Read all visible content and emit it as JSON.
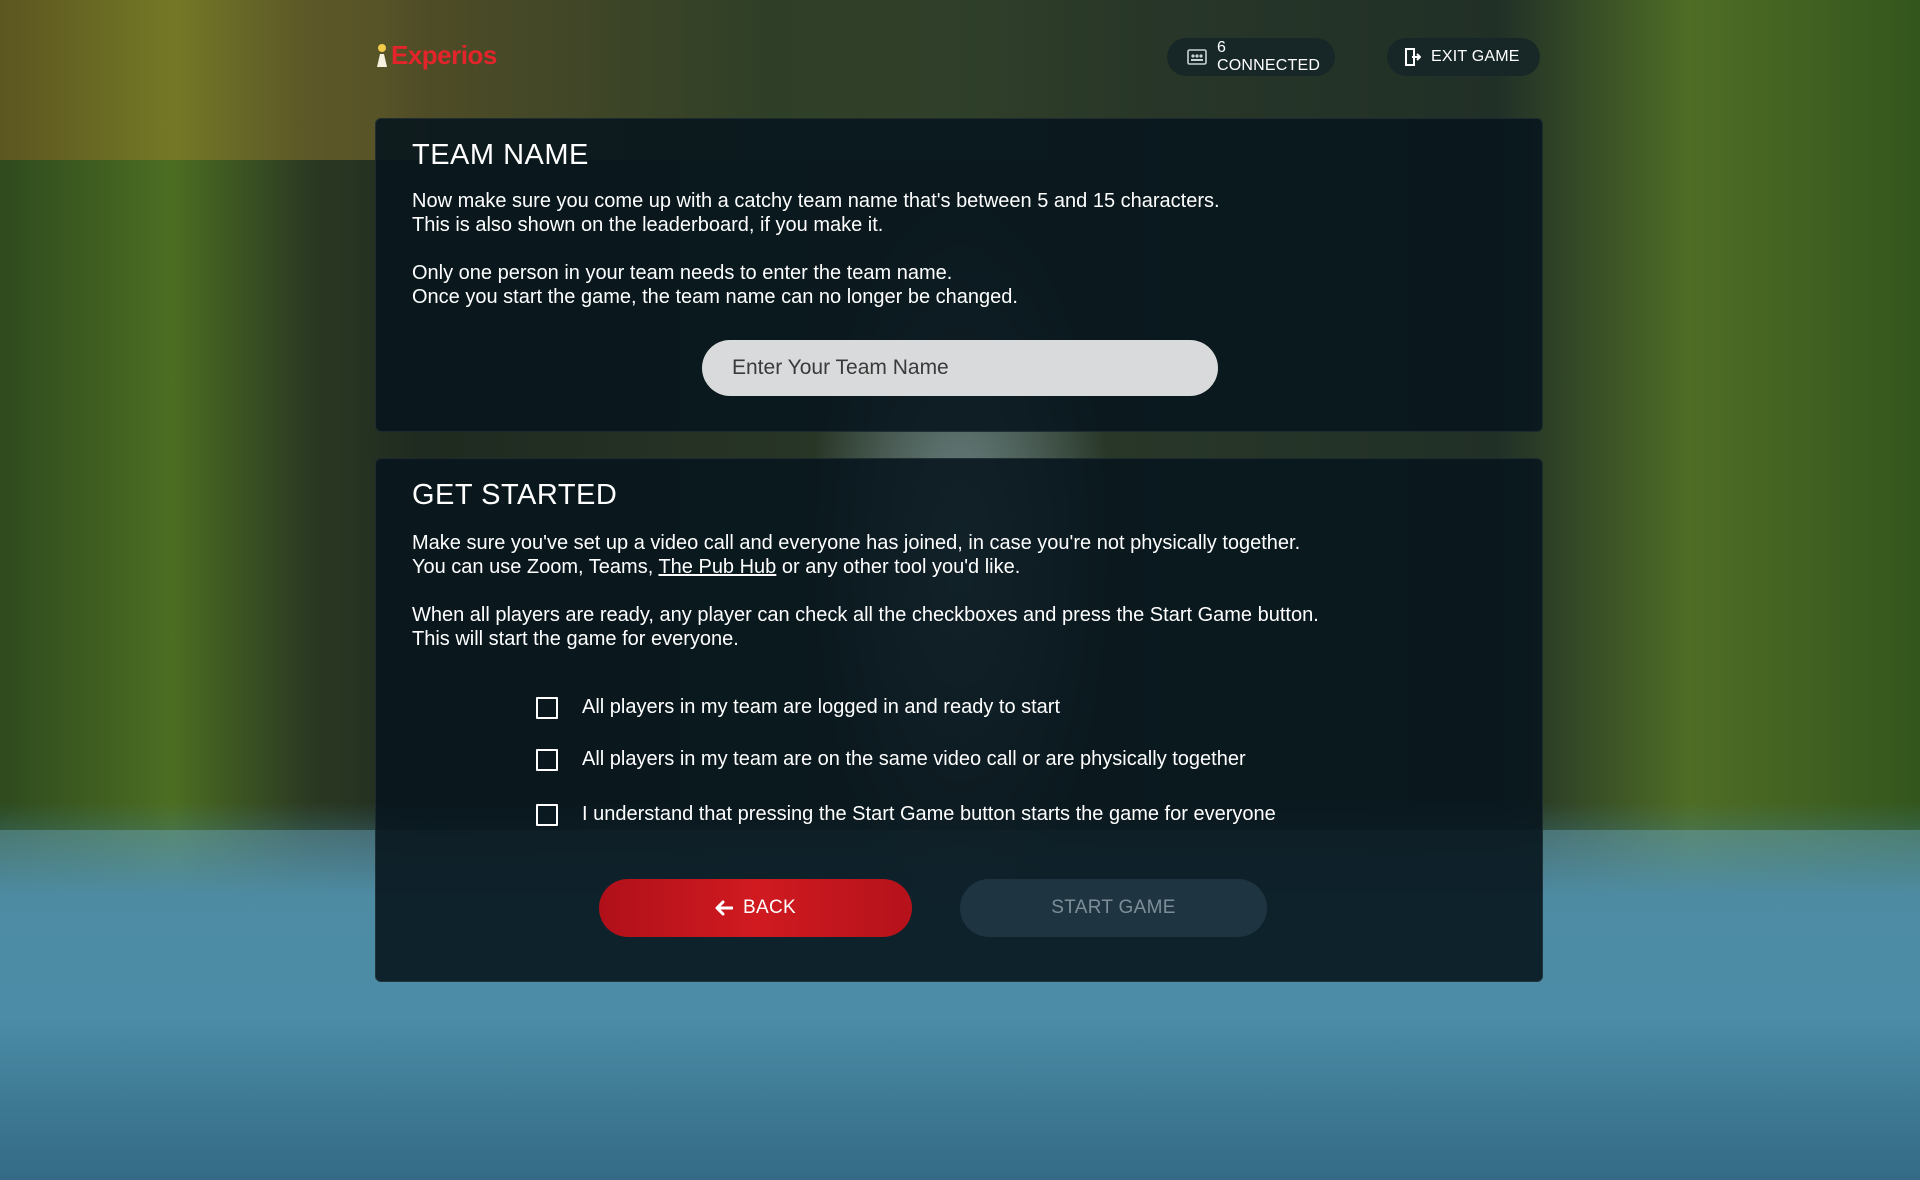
{
  "brand": {
    "logo_text": "Experios",
    "accent": "#e3242b"
  },
  "topbar": {
    "connected_label": "6 CONNECTED",
    "connected_icon": "players-icon",
    "exit_label": "EXIT GAME",
    "exit_icon": "exit-door-icon"
  },
  "team_name": {
    "title": "TEAM NAME",
    "line1": "Now make sure you come up with a catchy team name that's between 5 and 15 characters.",
    "line2": "This is also shown on the leaderboard, if you make it.",
    "line3": "Only one person in your team needs to enter the team name.",
    "line4": "Once you start the game, the team name can no longer be changed.",
    "input_placeholder": "Enter Your Team Name",
    "input_value": ""
  },
  "get_started": {
    "title": "GET STARTED",
    "line1": "Make sure you've set up a video call and everyone has joined, in case you're not physically together.",
    "line2_pre": "You can use Zoom, Teams, ",
    "line2_link": "The Pub Hub",
    "line2_post": " or any other tool you'd like.",
    "line3": "When all players are ready, any player can check all the checkboxes and press the Start Game button.",
    "line4": "This will start the game for everyone.",
    "checks": [
      {
        "label": "All players in my team are logged in and ready to start",
        "checked": false
      },
      {
        "label": "All players in my team are on the same video call or are physically together",
        "checked": false
      },
      {
        "label": "I understand that pressing the Start Game button starts the game for everyone",
        "checked": false
      }
    ],
    "back_label": "BACK",
    "back_icon": "arrow-left-icon",
    "start_label": "START GAME"
  }
}
